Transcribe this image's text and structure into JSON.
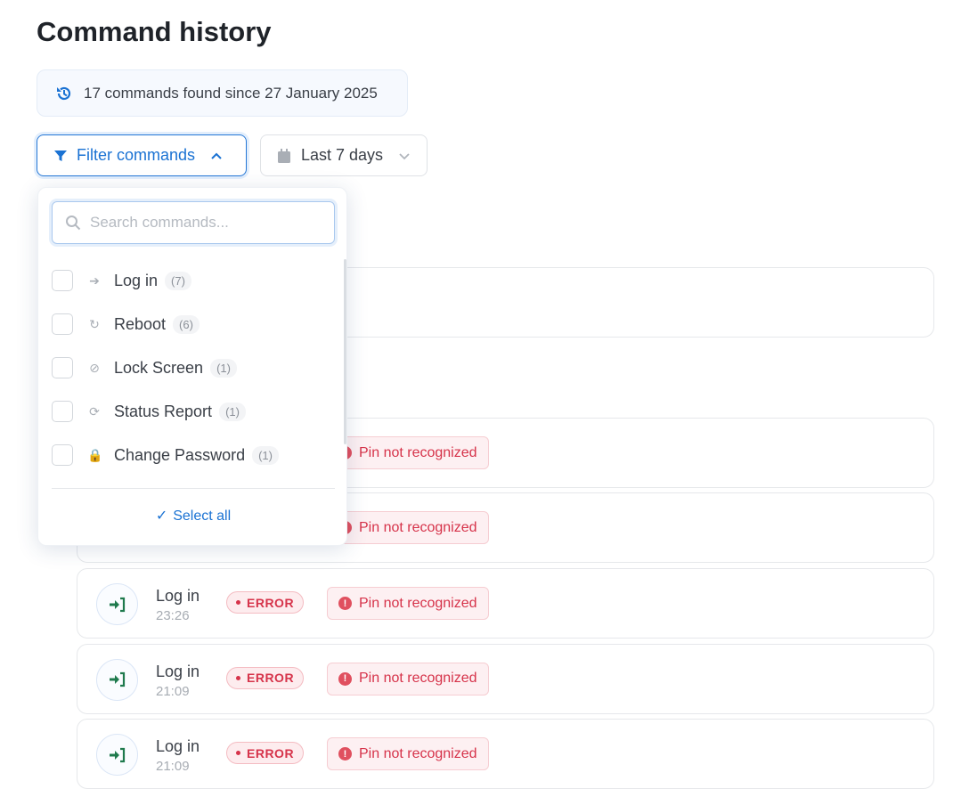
{
  "title": "Command history",
  "summary": "17 commands found since 27 January 2025",
  "filter_button": "Filter commands",
  "date_select": "Last 7 days",
  "dropdown": {
    "search_placeholder": "Search commands...",
    "items": [
      {
        "label": "Log in",
        "count": "(7)",
        "icon": "sign-in-icon"
      },
      {
        "label": "Reboot",
        "count": "(6)",
        "icon": "redo-icon"
      },
      {
        "label": "Lock Screen",
        "count": "(1)",
        "icon": "ban-icon"
      },
      {
        "label": "Status Report",
        "count": "(1)",
        "icon": "sync-icon"
      },
      {
        "label": "Change Password",
        "count": "(1)",
        "icon": "lock-icon"
      }
    ],
    "select_all": "Select all"
  },
  "rows": [
    {
      "name": "Log in",
      "time": "23:26",
      "status": "ERROR",
      "message": "Pin not recognized"
    },
    {
      "name": "Log in",
      "time": "21:09",
      "status": "ERROR",
      "message": "Pin not recognized"
    },
    {
      "name": "Log in",
      "time": "21:09",
      "status": "ERROR",
      "message": "Pin not recognized"
    }
  ],
  "hidden_rows": [
    {
      "message": "Pin not recognized"
    },
    {
      "message": "Pin not recognized"
    }
  ],
  "colors": {
    "accent": "#1a72d3",
    "error": "#d6334a",
    "success_icon": "#1f7a4d"
  }
}
